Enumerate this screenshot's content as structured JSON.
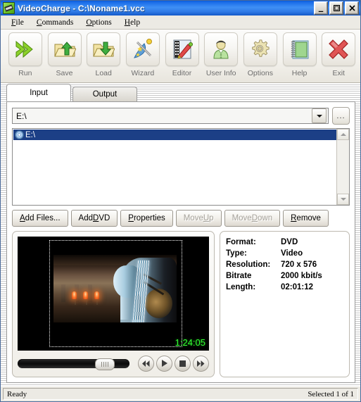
{
  "window": {
    "title": "VideoCharge - C:\\Noname1.vcc",
    "app_icon": "filmstrip-icon",
    "minimize_label": "_",
    "maximize_label": "❐",
    "close_label": "✕"
  },
  "menubar": {
    "items": [
      {
        "accel": "F",
        "rest": "ile",
        "name": "file"
      },
      {
        "accel": "C",
        "rest": "ommands",
        "name": "commands"
      },
      {
        "accel": "O",
        "rest": "ptions",
        "name": "options"
      },
      {
        "accel": "H",
        "rest": "elp",
        "name": "help"
      }
    ]
  },
  "toolbar": {
    "buttons": [
      {
        "label": "Run",
        "icon": "double-chevron-right-icon"
      },
      {
        "label": "Save",
        "icon": "folder-up-arrow-icon"
      },
      {
        "label": "Load",
        "icon": "folder-down-arrow-icon"
      },
      {
        "label": "Wizard",
        "icon": "magic-wand-icon"
      },
      {
        "label": "Editor",
        "icon": "film-pencil-icon"
      },
      {
        "label": "User Info",
        "icon": "user-icon"
      },
      {
        "label": "Options",
        "icon": "gear-icon"
      },
      {
        "label": "Help",
        "icon": "notebook-icon"
      },
      {
        "label": "Exit",
        "icon": "red-x-icon"
      }
    ]
  },
  "tabs": [
    {
      "label": "Input",
      "active": true
    },
    {
      "label": "Output",
      "active": false
    }
  ],
  "source": {
    "combo_value": "E:\\",
    "combo_placeholder": "",
    "browse_label": "...",
    "list": [
      {
        "label": "E:\\",
        "icon": "disc-icon",
        "selected": true
      }
    ]
  },
  "actions": [
    {
      "accel": "A",
      "pre": "",
      "post": "dd Files...",
      "enabled": true,
      "name": "add-files-button"
    },
    {
      "accel": "D",
      "pre": "Add ",
      "post": "VD",
      "enabled": true,
      "name": "add-dvd-button"
    },
    {
      "accel": "P",
      "pre": "",
      "post": "roperties",
      "enabled": true,
      "name": "properties-button"
    },
    {
      "accel": "U",
      "pre": "Move ",
      "post": "p",
      "enabled": false,
      "name": "move-up-button"
    },
    {
      "accel": "D",
      "pre": "Move ",
      "post": "own",
      "enabled": false,
      "name": "move-down-button"
    },
    {
      "accel": "R",
      "pre": "",
      "post": "emove",
      "enabled": true,
      "name": "remove-button"
    }
  ],
  "preview": {
    "timecode": "1:24:05",
    "seek_position_percent": 69,
    "controls": [
      {
        "icon": "rewind-icon",
        "glyph": "◀◀"
      },
      {
        "icon": "play-icon",
        "glyph": "▶"
      },
      {
        "icon": "stop-icon",
        "glyph": "■"
      },
      {
        "icon": "fast-forward-icon",
        "glyph": "▶▶"
      }
    ]
  },
  "info": {
    "rows": [
      {
        "label": "Format:",
        "value": "DVD"
      },
      {
        "label": "Type:",
        "value": "Video"
      },
      {
        "label": "Resolution:",
        "value": "720 x 576"
      },
      {
        "label": "Bitrate",
        "value": "2000 kbit/s"
      },
      {
        "label": "Length:",
        "value": "02:01:12"
      }
    ]
  },
  "statusbar": {
    "left": "Ready",
    "right": "Selected 1 of 1"
  },
  "colors": {
    "title_bar": "#2f7ae6",
    "selection": "#1c3f86",
    "timecode": "#33ff33",
    "face": "#eceae4"
  }
}
